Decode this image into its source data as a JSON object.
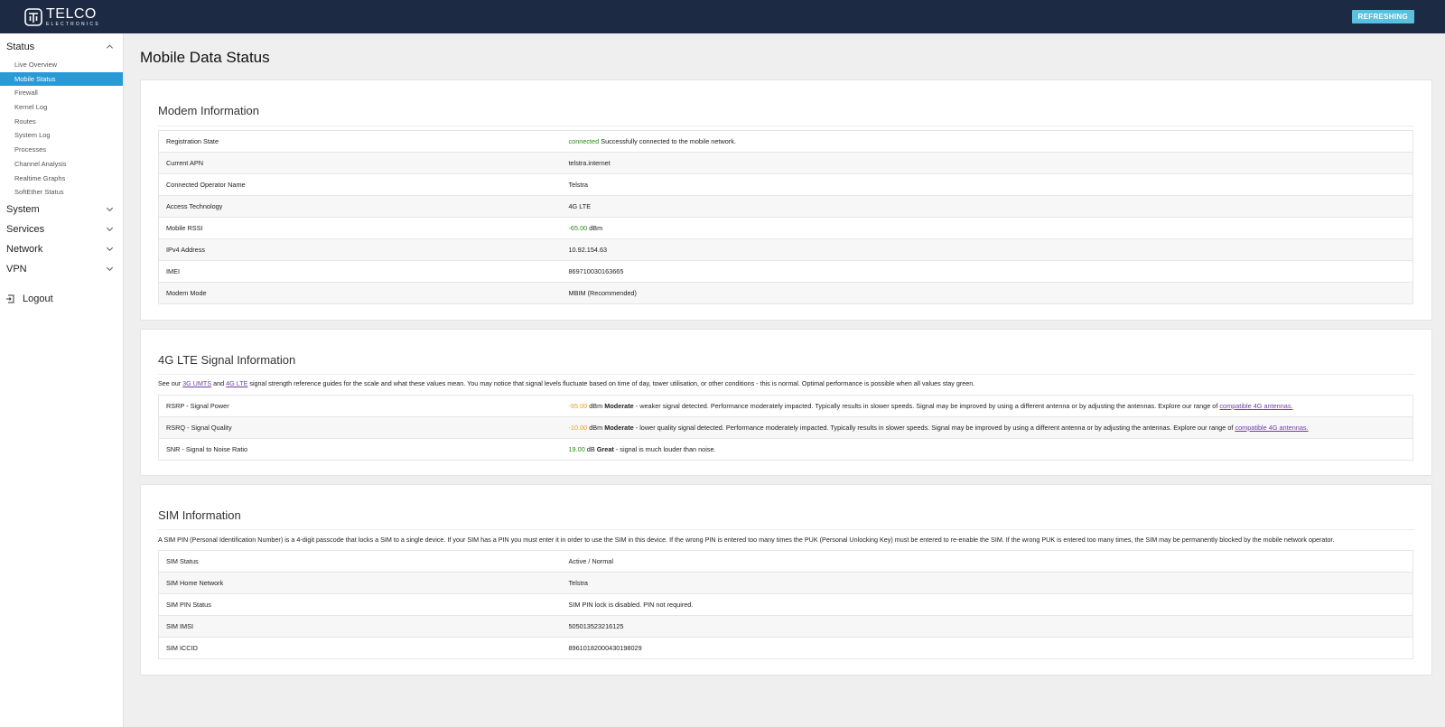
{
  "header": {
    "logo_main": "TELCO",
    "logo_sub": "ELECTRONICS",
    "refresh_label": "REFRESHING"
  },
  "sidebar": {
    "status_label": "Status",
    "status_items": [
      {
        "label": "Live Overview"
      },
      {
        "label": "Mobile Status",
        "active": true
      },
      {
        "label": "Firewall"
      },
      {
        "label": "Kernel Log"
      },
      {
        "label": "Routes"
      },
      {
        "label": "System Log"
      },
      {
        "label": "Processes"
      },
      {
        "label": "Channel Analysis"
      },
      {
        "label": "Realtime Graphs"
      },
      {
        "label": "SoftEther Status"
      }
    ],
    "sections": [
      "System",
      "Services",
      "Network",
      "VPN"
    ],
    "logout_label": "Logout"
  },
  "page_title": "Mobile Data Status",
  "modem": {
    "title": "Modem Information",
    "rows": [
      {
        "label": "Registration State",
        "status": "connected",
        "text": " Successfully connected to the mobile network."
      },
      {
        "label": "Current APN",
        "value": "telstra.internet"
      },
      {
        "label": "Connected Operator Name",
        "value": "Telstra"
      },
      {
        "label": "Access Technology",
        "value": "4G LTE"
      },
      {
        "label": "Mobile RSSI",
        "num": "-65.00",
        "unit": " dBm"
      },
      {
        "label": "IPv4 Address",
        "value": "10.92.154.63"
      },
      {
        "label": "IMEI",
        "value": "869710030163665"
      },
      {
        "label": "Modem Mode",
        "value": "MBIM (Recommended)"
      }
    ]
  },
  "signal": {
    "title": "4G LTE Signal Information",
    "desc_1": "See our ",
    "link_3g": "3G UMTS",
    "desc_2": " and ",
    "link_4g": "4G LTE",
    "desc_3": " signal strength reference guides for the scale and what these values mean. You may notice that signal levels fluctuate based on time of day, tower utilisation, or other conditions - this is normal. Optimal performance is possible when all values stay green.",
    "rsrp_label": "RSRP - Signal Power",
    "rsrp_num": "-95.00",
    "rsrp_unit": " dBm ",
    "rsrp_rating": "Moderate",
    "rsrp_text": " - weaker signal detected. Performance moderately impacted. Typically results in slower speeds. Signal may be improved by using a different antenna or by adjusting the antennas. Explore our range of ",
    "rsrp_link": "compatible 4G antennas.",
    "rsrq_label": "RSRQ - Signal Quality",
    "rsrq_num": "-10.00",
    "rsrq_unit": " dBm ",
    "rsrq_rating": "Moderate",
    "rsrq_text": " - lower quality signal detected. Performance moderately impacted. Typically results in slower speeds. Signal may be improved by using a different antenna or by adjusting the antennas. Explore our range of ",
    "rsrq_link": "compatible 4G antennas.",
    "snr_label": "SNR - Signal to Noise Ratio",
    "snr_num": "19.00",
    "snr_unit": " dB ",
    "snr_rating": "Great",
    "snr_text": " - signal is much louder than noise."
  },
  "sim": {
    "title": "SIM Information",
    "desc": "A SIM PIN (Personal Identification Number) is a 4-digit passcode that locks a SIM to a single device. If your SIM has a PIN you must enter it in order to use the SIM in this device. If the wrong PIN is entered too many times the PUK (Personal Unlocking Key) must be entered to re-enable the SIM. If the wrong PUK is entered too many times, the SIM may be permanently blocked by the mobile network operator.",
    "rows": [
      {
        "label": "SIM Status",
        "value": "Active / Normal"
      },
      {
        "label": "SIM Home Network",
        "value": "Telstra"
      },
      {
        "label": "SIM PIN Status",
        "value": "SIM PIN lock is disabled. PIN not required."
      },
      {
        "label": "SIM IMSI",
        "value": "505013523216125"
      },
      {
        "label": "SIM ICCID",
        "value": "89610182000430198029"
      }
    ]
  },
  "colors": {
    "header_bg": "#1d2a44",
    "active_item": "#2a9ad4",
    "refresh_badge": "#5bc0de",
    "good": "#2a8a1a",
    "warning": "#e8a020",
    "link": "#6b3fa0"
  }
}
